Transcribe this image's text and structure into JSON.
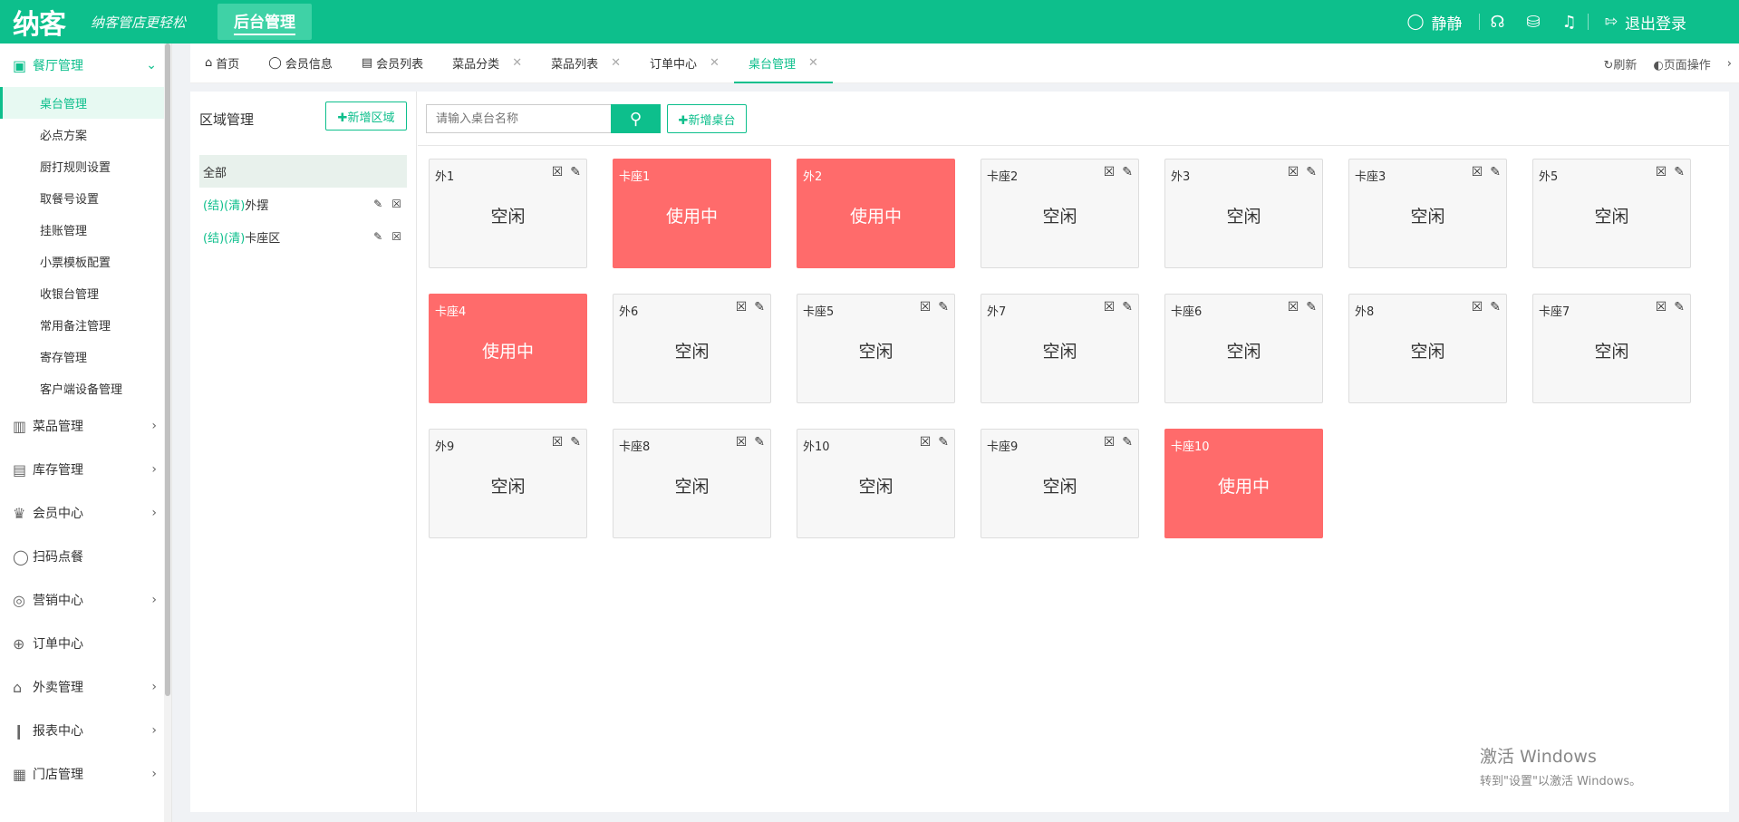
{
  "header": {
    "logo": "纳客",
    "slogan": "纳客管店更轻松",
    "nav_label": "后台管理",
    "user": "静静",
    "logout": "退出登录"
  },
  "sidebar": {
    "groups": [
      {
        "label": "餐厅管理",
        "icon": "restaurant-icon",
        "expanded": true
      },
      {
        "label": "菜品管理",
        "icon": "dishes-icon"
      },
      {
        "label": "库存管理",
        "icon": "inventory-icon"
      },
      {
        "label": "会员中心",
        "icon": "crown-icon"
      },
      {
        "label": "扫码点餐",
        "icon": "user-icon"
      },
      {
        "label": "营销中心",
        "icon": "target-icon"
      },
      {
        "label": "订单中心",
        "icon": "globe-icon"
      },
      {
        "label": "外卖管理",
        "icon": "bell-cloche-icon"
      },
      {
        "label": "报表中心",
        "icon": "chart-icon"
      },
      {
        "label": "门店管理",
        "icon": "store-icon"
      }
    ],
    "sub_items": [
      "桌台管理",
      "必点方案",
      "厨打规则设置",
      "取餐号设置",
      "挂账管理",
      "小票模板配置",
      "收银台管理",
      "常用备注管理",
      "寄存管理",
      "客户端设备管理"
    ]
  },
  "tabs": {
    "items": [
      {
        "label": "首页"
      },
      {
        "label": "会员信息"
      },
      {
        "label": "会员列表"
      },
      {
        "label": "菜品分类"
      },
      {
        "label": "菜品列表"
      },
      {
        "label": "订单中心"
      },
      {
        "label": "桌台管理"
      }
    ],
    "refresh": "刷新",
    "page_ops": "页面操作"
  },
  "area": {
    "title": "区域管理",
    "add_button": "✚新增区域",
    "all_label": "全部",
    "items": [
      {
        "tag": "(结)(清)",
        "name": "外摆"
      },
      {
        "tag": "(结)(清)",
        "name": "卡座区"
      }
    ]
  },
  "tables": {
    "search_placeholder": "请输入桌台名称",
    "add_button": "✚新增桌台",
    "busy_color": "#ff6b6b",
    "items": [
      {
        "name": "外1",
        "status": "空闲",
        "busy": false
      },
      {
        "name": "卡座1",
        "status": "使用中",
        "busy": true
      },
      {
        "name": "外2",
        "status": "使用中",
        "busy": true
      },
      {
        "name": "卡座2",
        "status": "空闲",
        "busy": false
      },
      {
        "name": "外3",
        "status": "空闲",
        "busy": false
      },
      {
        "name": "卡座3",
        "status": "空闲",
        "busy": false
      },
      {
        "name": "外5",
        "status": "空闲",
        "busy": false
      },
      {
        "name": "卡座4",
        "status": "使用中",
        "busy": true
      },
      {
        "name": "外6",
        "status": "空闲",
        "busy": false
      },
      {
        "name": "卡座5",
        "status": "空闲",
        "busy": false
      },
      {
        "name": "外7",
        "status": "空闲",
        "busy": false
      },
      {
        "name": "卡座6",
        "status": "空闲",
        "busy": false
      },
      {
        "name": "外8",
        "status": "空闲",
        "busy": false
      },
      {
        "name": "卡座7",
        "status": "空闲",
        "busy": false
      },
      {
        "name": "外9",
        "status": "空闲",
        "busy": false
      },
      {
        "name": "卡座8",
        "status": "空闲",
        "busy": false
      },
      {
        "name": "外10",
        "status": "空闲",
        "busy": false
      },
      {
        "name": "卡座9",
        "status": "空闲",
        "busy": false
      },
      {
        "name": "卡座10",
        "status": "使用中",
        "busy": true
      }
    ]
  },
  "watermark": {
    "line1": "激活 Windows",
    "line2": "转到\"设置\"以激活 Windows。"
  }
}
